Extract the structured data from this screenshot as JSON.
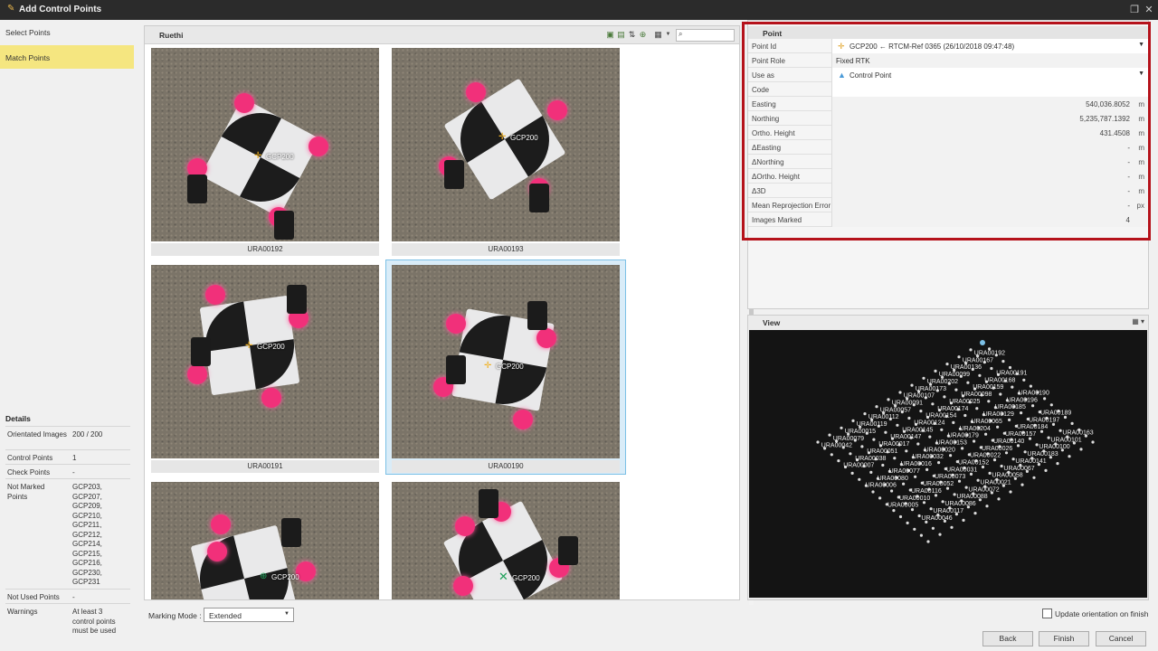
{
  "window": {
    "title": "Add Control Points"
  },
  "steps": [
    {
      "label": "Select Points"
    },
    {
      "label": "Match Points"
    }
  ],
  "details": {
    "title": "Details",
    "rows": [
      {
        "k": "Orientated Images",
        "v": "200 / 200"
      },
      {
        "k": "Control Points",
        "v": "1"
      },
      {
        "k": "Check Points",
        "v": "-"
      },
      {
        "k": "Not Marked Points",
        "v": "GCP203, GCP207, GCP209, GCP210, GCP211, GCP212, GCP214, GCP215, GCP216, GCP230, GCP231"
      },
      {
        "k": "Not Used Points",
        "v": "-"
      },
      {
        "k": "Warnings",
        "v": "At least 3 control points must be used"
      }
    ]
  },
  "gallery": {
    "title": "Ruethi",
    "search": {
      "placeholder": ""
    },
    "images": [
      {
        "name": "URA00192",
        "marker": "GCP200"
      },
      {
        "name": "URA00193",
        "marker": "GCP200"
      },
      {
        "name": "URA00191",
        "marker": "GCP200"
      },
      {
        "name": "URA00190",
        "marker": "GCP200"
      },
      {
        "name": "",
        "marker": "GCP200"
      },
      {
        "name": "",
        "marker": "GCP200"
      }
    ]
  },
  "point": {
    "title": "Point",
    "rows": [
      {
        "k": "Point Id",
        "v": "GCP200 ← RTCM-Ref 0365 (26/10/2018 09:47:48)",
        "u": ""
      },
      {
        "k": "Point Role",
        "v": "Fixed RTK",
        "u": ""
      },
      {
        "k": "Use as",
        "v": "Control Point",
        "u": ""
      },
      {
        "k": "Code",
        "v": "",
        "u": ""
      },
      {
        "k": "Easting",
        "v": "540,036.8052",
        "u": "m"
      },
      {
        "k": "Northing",
        "v": "5,235,787.1392",
        "u": "m"
      },
      {
        "k": "Ortho. Height",
        "v": "431.4508",
        "u": "m"
      },
      {
        "k": "ΔEasting",
        "v": "-",
        "u": "m"
      },
      {
        "k": "ΔNorthing",
        "v": "-",
        "u": "m"
      },
      {
        "k": "ΔOrtho. Height",
        "v": "-",
        "u": "m"
      },
      {
        "k": "Δ3D",
        "v": "-",
        "u": "m"
      },
      {
        "k": "Mean Reprojection Error",
        "v": "-",
        "u": "px"
      },
      {
        "k": "Images Marked",
        "v": "4",
        "u": ""
      }
    ]
  },
  "view": {
    "title": "View",
    "labels": [
      "URA00192",
      "URA00191",
      "URA00190",
      "URA00189",
      "URA00163",
      "URA00167",
      "URA00168",
      "URA00196",
      "URA00197",
      "URA00101",
      "URA00136",
      "URA00159",
      "URA00185",
      "URA00184",
      "URA00100",
      "URA00099",
      "URA00098",
      "URA00129",
      "URA00157",
      "URA00183",
      "URA00202",
      "URA00025",
      "URA00065",
      "URA00140",
      "URA00141",
      "URA00173",
      "URA00174",
      "URA00204",
      "URA00026",
      "URA00067",
      "URA00107",
      "URA00154",
      "URA00179",
      "URA00022",
      "URA00058",
      "URA00091",
      "URA00124",
      "URA00153",
      "URA00152",
      "URA00021",
      "URA00057",
      "URA00145",
      "URA00020",
      "URA00031",
      "URA00072",
      "URA00112",
      "URA00147",
      "URA00032",
      "URA00073",
      "URA00088",
      "URA00119",
      "URA00017",
      "URA00016",
      "URA00052",
      "URA00086",
      "URA00015",
      "URA00051",
      "URA00077",
      "URA00116",
      "URA00117",
      "URA00079",
      "URA00038",
      "URA00080",
      "URA00010",
      "URA00046",
      "URA00042",
      "URA00007",
      "URA00006",
      "URA00005"
    ]
  },
  "bottom": {
    "marking_mode_label": "Marking Mode :",
    "marking_mode_value": "Extended",
    "update_label": "Update orientation on finish",
    "back": "Back",
    "finish": "Finish",
    "cancel": "Cancel"
  }
}
